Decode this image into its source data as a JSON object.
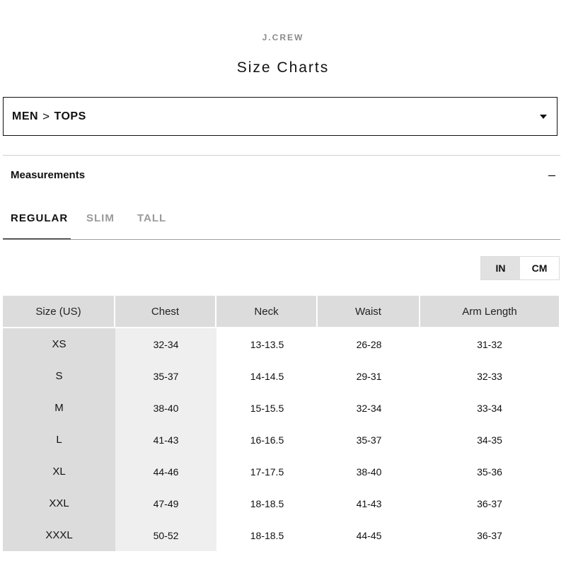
{
  "header": {
    "brand": "J.CREW",
    "title": "Size Charts"
  },
  "selector": {
    "category": "MEN",
    "separator": ">",
    "subcategory": "TOPS"
  },
  "accordion": {
    "title": "Measurements",
    "toggle": "–"
  },
  "tabs": [
    {
      "label": "REGULAR",
      "active": true
    },
    {
      "label": "SLIM",
      "active": false
    },
    {
      "label": "TALL",
      "active": false
    }
  ],
  "units": [
    {
      "label": "IN",
      "active": true
    },
    {
      "label": "CM",
      "active": false
    }
  ],
  "table": {
    "headers": [
      "Size (US)",
      "Chest",
      "Neck",
      "Waist",
      "Arm Length"
    ],
    "rows": [
      [
        "XS",
        "32-34",
        "13-13.5",
        "26-28",
        "31-32"
      ],
      [
        "S",
        "35-37",
        "14-14.5",
        "29-31",
        "32-33"
      ],
      [
        "M",
        "38-40",
        "15-15.5",
        "32-34",
        "33-34"
      ],
      [
        "L",
        "41-43",
        "16-16.5",
        "35-37",
        "34-35"
      ],
      [
        "XL",
        "44-46",
        "17-17.5",
        "38-40",
        "35-36"
      ],
      [
        "XXL",
        "47-49",
        "18-18.5",
        "41-43",
        "36-37"
      ],
      [
        "XXXL",
        "50-52",
        "18-18.5",
        "44-45",
        "36-37"
      ]
    ]
  }
}
